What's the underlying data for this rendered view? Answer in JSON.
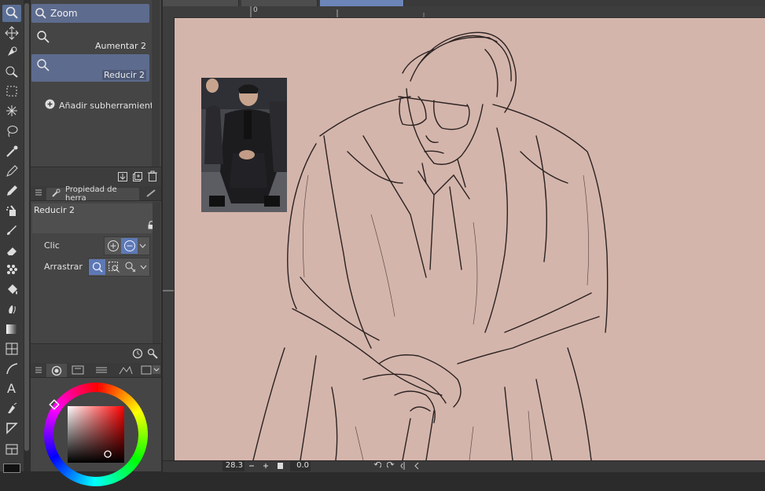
{
  "colors": {
    "accent": "#5d79b5",
    "panel": "#454545",
    "paper": "#d4b5ab",
    "selection": "#5d6b8e"
  },
  "toolbar": {
    "tools": [
      {
        "name": "zoom-icon",
        "active": true
      },
      {
        "name": "move-icon"
      },
      {
        "name": "operation-icon"
      },
      {
        "name": "move-layer-icon"
      },
      {
        "name": "selection-icon"
      },
      {
        "name": "auto-select-icon"
      },
      {
        "name": "lasso-icon"
      },
      {
        "name": "eyedropper-icon"
      },
      {
        "name": "pen-icon"
      },
      {
        "name": "pencil-icon"
      },
      {
        "name": "airbrush-icon"
      },
      {
        "name": "brush-icon"
      },
      {
        "name": "eraser-icon"
      },
      {
        "name": "decoration-icon"
      },
      {
        "name": "fill-icon"
      },
      {
        "name": "blend-icon"
      },
      {
        "name": "gradient-icon"
      },
      {
        "name": "figure-icon"
      },
      {
        "name": "curve-icon"
      },
      {
        "name": "text-icon"
      },
      {
        "name": "balloon-icon"
      },
      {
        "name": "ruler-icon"
      },
      {
        "name": "frame-icon"
      }
    ]
  },
  "subtool": {
    "group_label": "Zoom",
    "items": [
      {
        "label": "Aumentar 2"
      },
      {
        "label": "Reducir 2"
      }
    ],
    "add_label": "Añadir subherramienta"
  },
  "toolprop": {
    "tab_label": "Propiedad de herra",
    "tool_name": "Reducir 2",
    "click_label": "Clic",
    "drag_label": "Arrastrar"
  },
  "status": {
    "zoom": "28.3",
    "angle": "0.0"
  }
}
